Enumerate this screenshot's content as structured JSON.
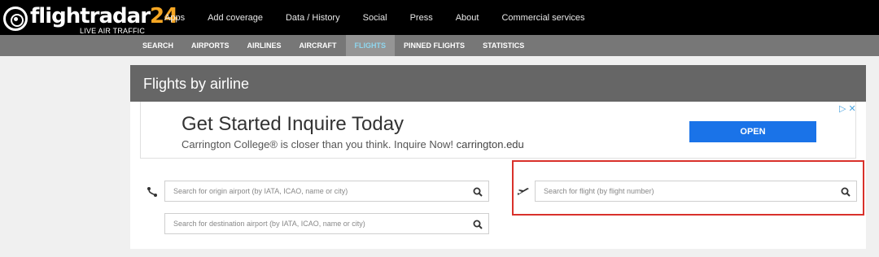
{
  "brand": {
    "name": "flightradar",
    "number": "24",
    "tagline": "LIVE AIR TRAFFIC"
  },
  "nav": [
    {
      "label": "Apps"
    },
    {
      "label": "Add coverage"
    },
    {
      "label": "Data / History"
    },
    {
      "label": "Social"
    },
    {
      "label": "Press"
    },
    {
      "label": "About"
    },
    {
      "label": "Commercial services"
    }
  ],
  "subnav": [
    {
      "label": "SEARCH"
    },
    {
      "label": "AIRPORTS"
    },
    {
      "label": "AIRLINES"
    },
    {
      "label": "AIRCRAFT"
    },
    {
      "label": "FLIGHTS",
      "active": true
    },
    {
      "label": "PINNED FLIGHTS"
    },
    {
      "label": "STATISTICS"
    }
  ],
  "card": {
    "title": "Flights by airline"
  },
  "ad": {
    "headline": "Get Started Inquire Today",
    "body": "Carrington College® is closer than you think. Inquire Now!",
    "domain": "carrington.edu",
    "cta": "OPEN",
    "choices": "▷ ✕"
  },
  "search": {
    "origin_placeholder": "Search for origin airport (by IATA, ICAO, name or city)",
    "destination_placeholder": "Search for destination airport (by IATA, ICAO, name or city)",
    "flight_placeholder": "Search for flight (by flight number)",
    "origin_value": "",
    "destination_value": "",
    "flight_value": ""
  },
  "colors": {
    "accent": "#f5a623",
    "active_tab": "#8fd6ee",
    "cta": "#1a73e8",
    "highlight": "#d9312b"
  },
  "icons": {
    "search": "magnifier-icon",
    "route": "route-icon",
    "plane": "plane-icon"
  }
}
